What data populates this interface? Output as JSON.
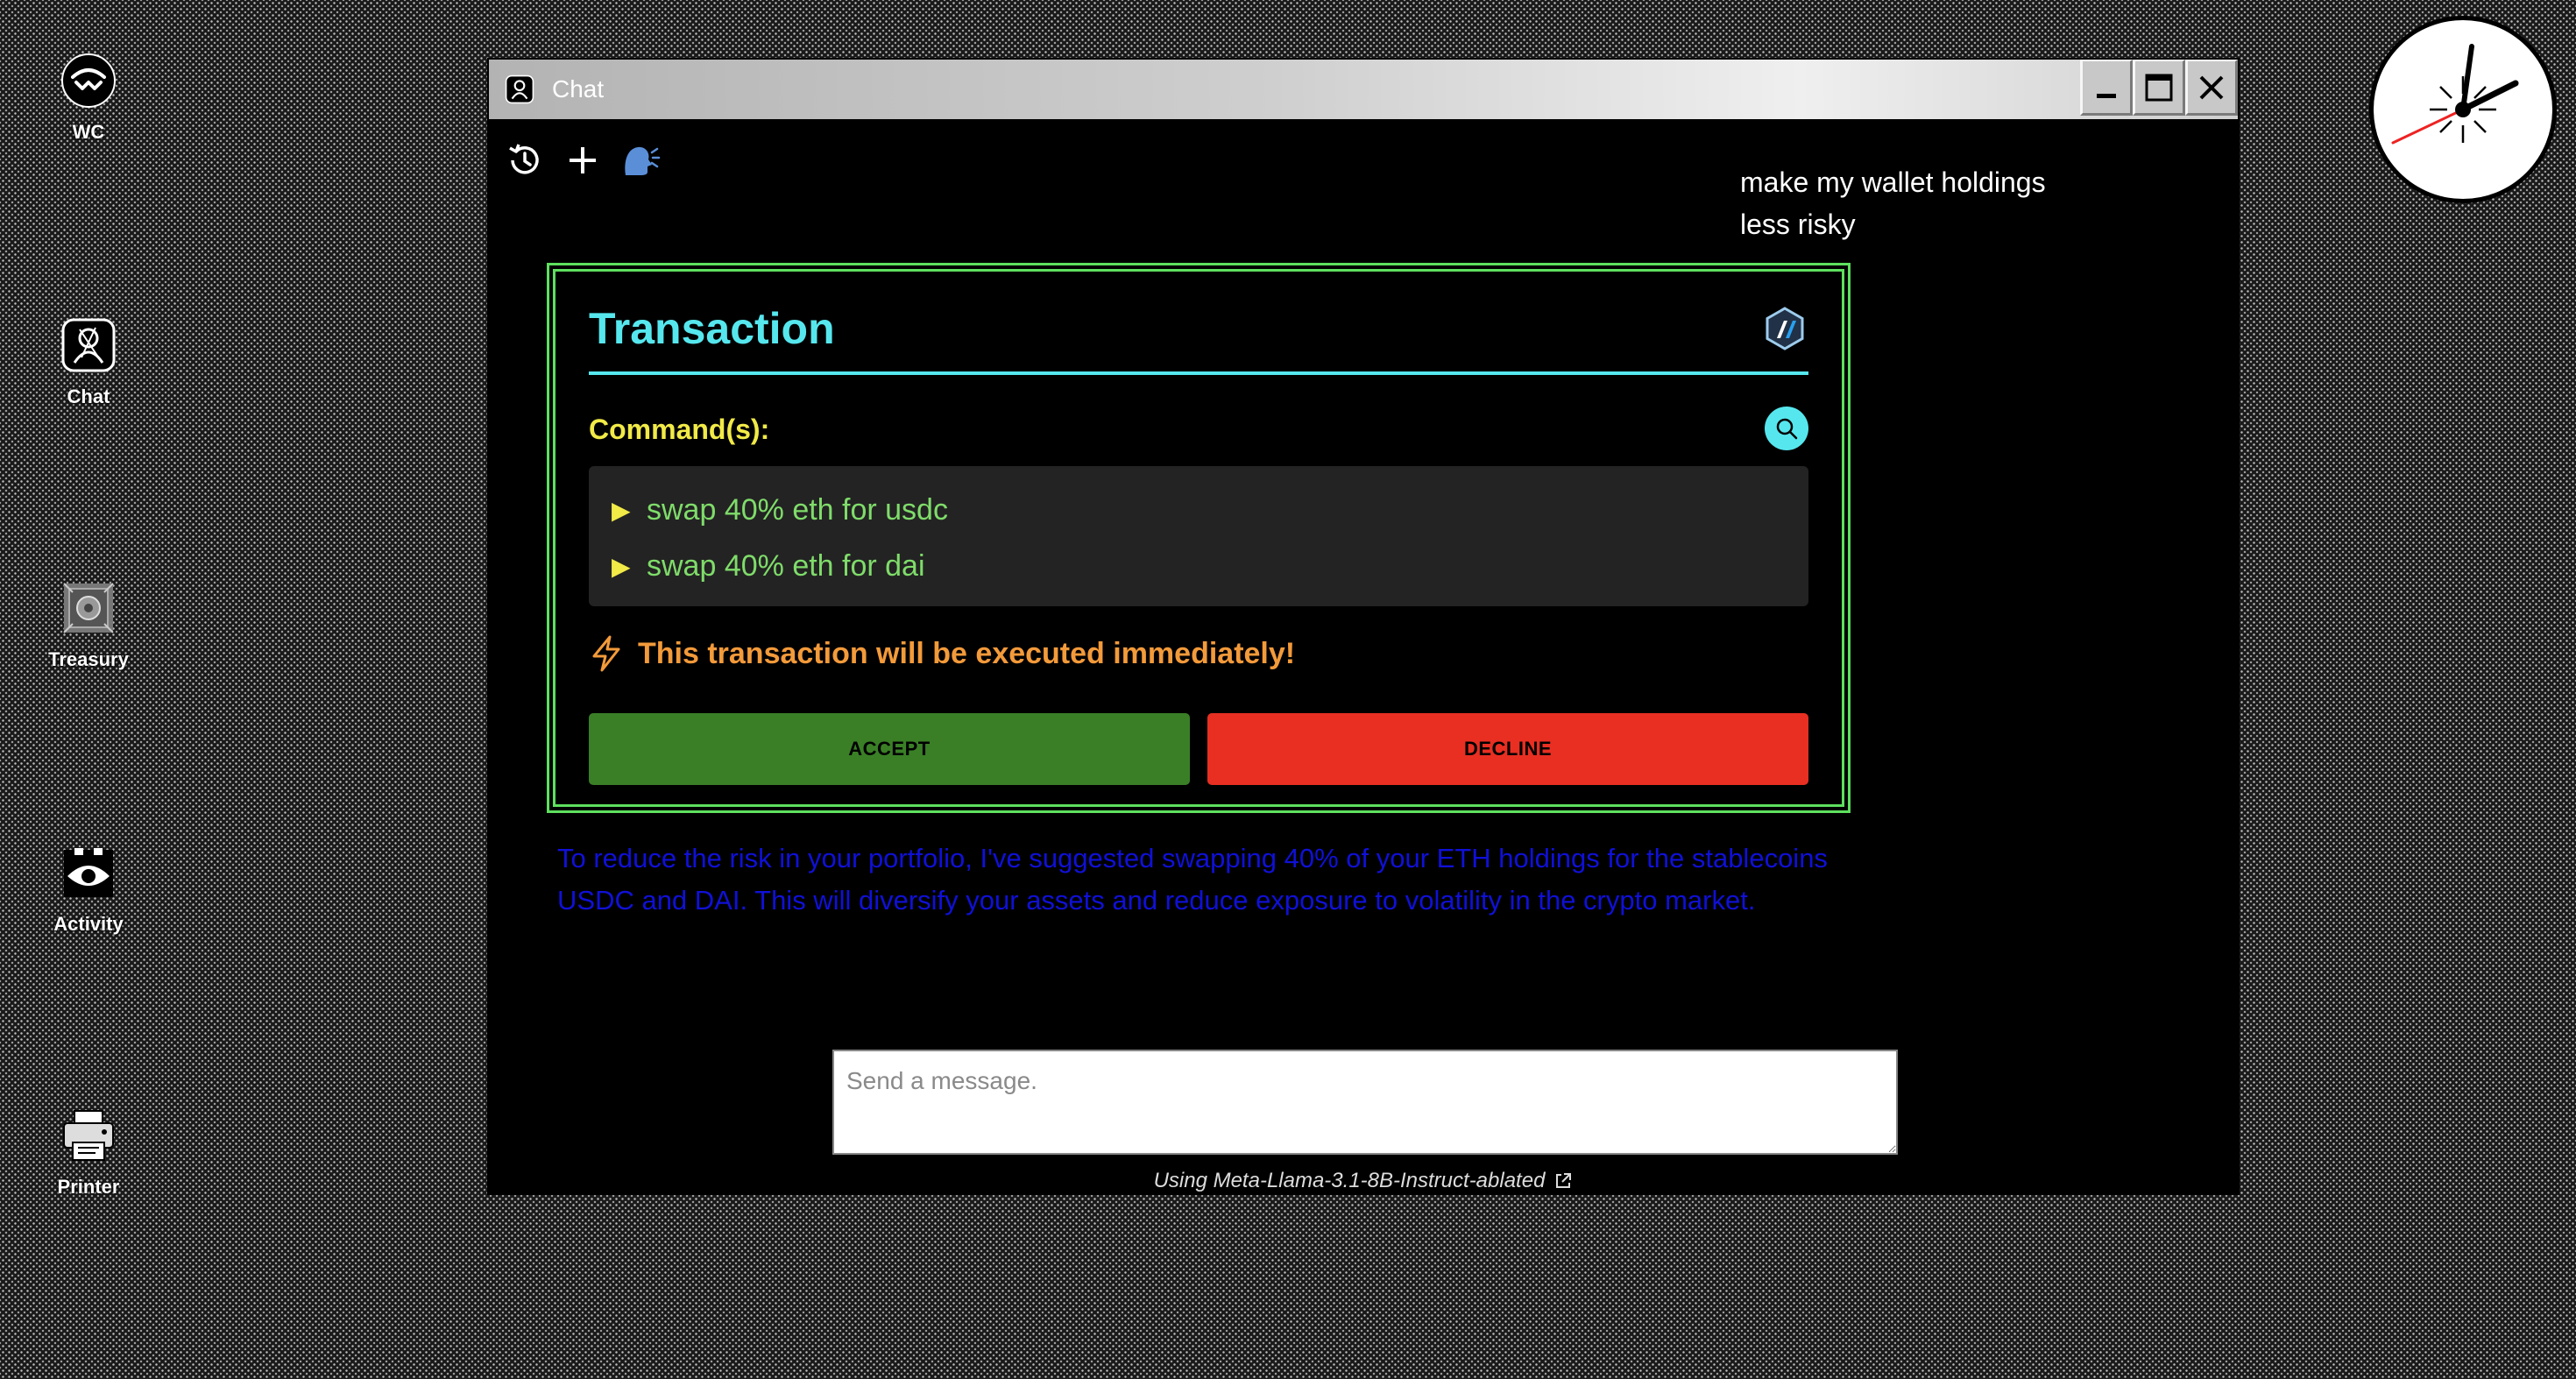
{
  "desktop": {
    "icons": [
      {
        "label": "WC",
        "icon": "walletconnect-icon"
      },
      {
        "label": "Chat",
        "icon": "chat-icon"
      },
      {
        "label": "Treasury",
        "icon": "treasury-icon"
      },
      {
        "label": "Activity",
        "icon": "eye-icon"
      },
      {
        "label": "Printer",
        "icon": "printer-icon"
      }
    ]
  },
  "window": {
    "title": "Chat",
    "controls": [
      "minimize-icon",
      "maximize-icon",
      "close-icon"
    ]
  },
  "toolbar": {
    "buttons": [
      "history-icon",
      "plus-icon",
      "speaking-head-icon"
    ]
  },
  "conversation": {
    "user_message": "make my wallet holdings less risky",
    "transaction": {
      "title": "Transaction",
      "chain_icon": "arbitrum-icon",
      "commands_label": "Command(s):",
      "commands": [
        "swap 40% eth for usdc",
        "swap 40% eth for dai"
      ],
      "warning": "This transaction will be executed immediately!",
      "accept_label": "ACCEPT",
      "decline_label": "DECLINE"
    },
    "assistant_message": "To reduce the risk in your portfolio, I've suggested swapping 40% of your ETH holdings for the stablecoins USDC and DAI. This will diversify your assets and reduce exposure to volatility in the crypto market."
  },
  "composer": {
    "placeholder": "Send a message.",
    "model_info": "Using Meta-Llama-3.1-8B-Instruct-ablated"
  },
  "colors": {
    "accent_cyan": "#56e7ee",
    "border_green": "#5ee05e",
    "command_green": "#7fdc6a",
    "label_yellow": "#f1ea47",
    "warning_orange": "#f39a3a",
    "accept_green": "#3a7f26",
    "decline_red": "#e82f22",
    "assistant_blue": "#1010d8"
  }
}
